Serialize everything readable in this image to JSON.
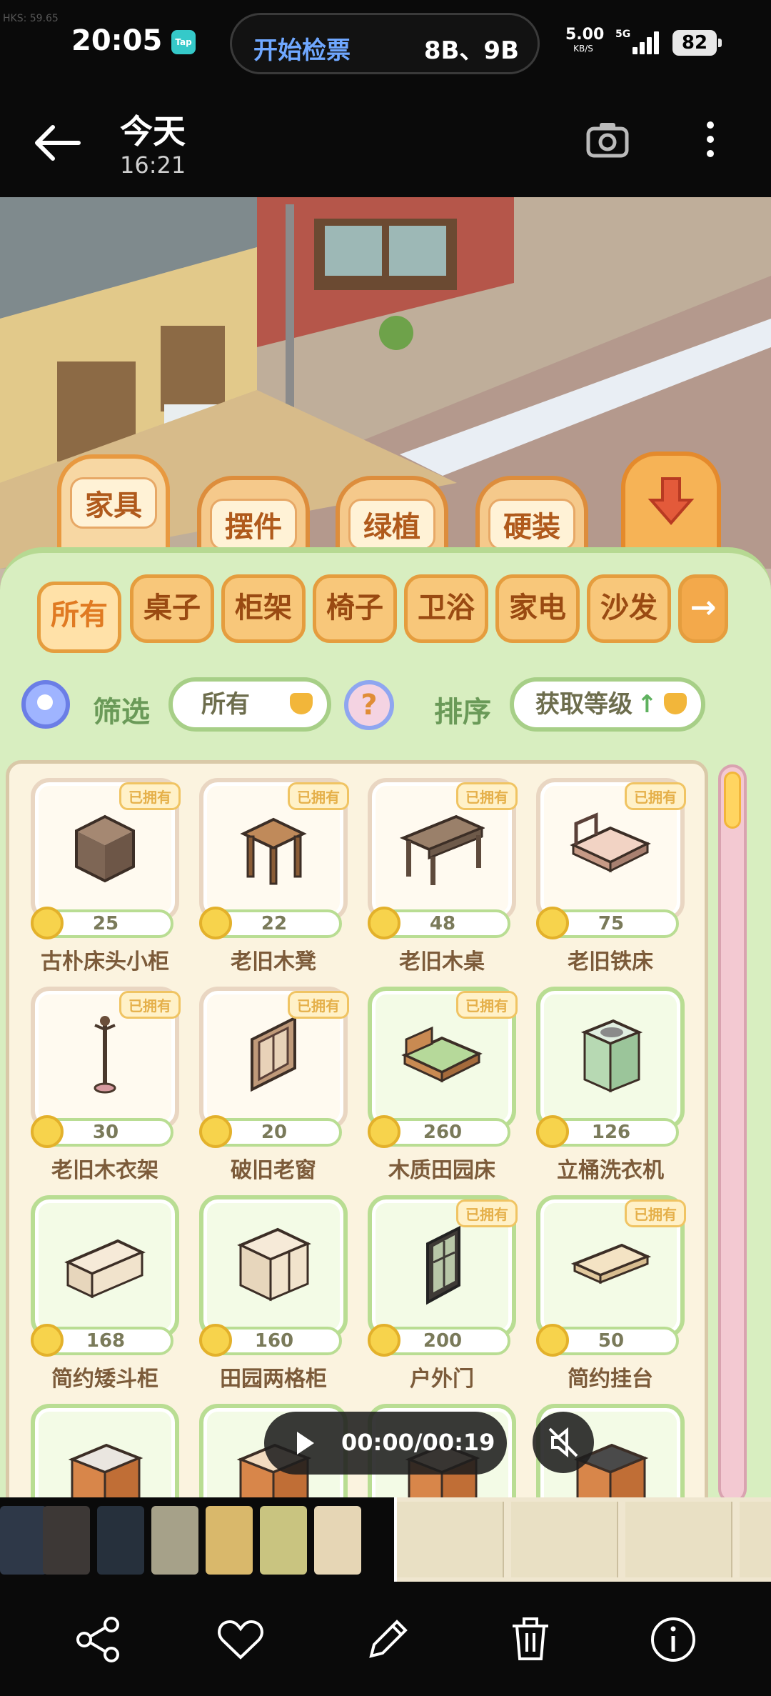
{
  "status_bar": {
    "time": "20:05",
    "tap_badge": "Tap",
    "pill_left": "开始检票",
    "pill_right": "8B、9B",
    "net_speed": "5.00",
    "net_unit": "KB/S",
    "network_type": "5G",
    "battery": "82",
    "faint_text": "HKS: 59.65"
  },
  "top_bar": {
    "title": "今天",
    "subtitle": "16:21"
  },
  "game": {
    "category_tabs": [
      "家具",
      "摆件",
      "绿植",
      "硬装"
    ],
    "active_category": "家具",
    "subtabs": [
      "所有",
      "桌子",
      "柜架",
      "椅子",
      "卫浴",
      "家电",
      "沙发"
    ],
    "active_subtab": "所有",
    "filter_label": "筛选",
    "filter_value": "所有",
    "help_label": "?",
    "sort_label": "排序",
    "sort_value": "获取等级",
    "owned_label": "已拥有",
    "items": [
      {
        "name": "古朴床头小柜",
        "price": "25",
        "owned": true,
        "icon": "cabinet-icon"
      },
      {
        "name": "老旧木凳",
        "price": "22",
        "owned": true,
        "icon": "stool-icon"
      },
      {
        "name": "老旧木桌",
        "price": "48",
        "owned": true,
        "icon": "table-icon"
      },
      {
        "name": "老旧铁床",
        "price": "75",
        "owned": true,
        "icon": "bed-icon"
      },
      {
        "name": "老旧木衣架",
        "price": "30",
        "owned": true,
        "icon": "coat-rack-icon"
      },
      {
        "name": "破旧老窗",
        "price": "20",
        "owned": true,
        "icon": "window-icon"
      },
      {
        "name": "木质田园床",
        "price": "260",
        "owned": true,
        "icon": "bed-icon"
      },
      {
        "name": "立桶洗衣机",
        "price": "126",
        "owned": false,
        "icon": "washing-machine-icon"
      },
      {
        "name": "简约矮斗柜",
        "price": "168",
        "owned": false,
        "icon": "low-cabinet-icon"
      },
      {
        "name": "田园两格柜",
        "price": "160",
        "owned": false,
        "icon": "cabinet-icon"
      },
      {
        "name": "户外门",
        "price": "200",
        "owned": true,
        "icon": "door-icon"
      },
      {
        "name": "简约挂台",
        "price": "50",
        "owned": true,
        "icon": "shelf-icon"
      }
    ]
  },
  "video": {
    "time": "00:00/00:19"
  }
}
